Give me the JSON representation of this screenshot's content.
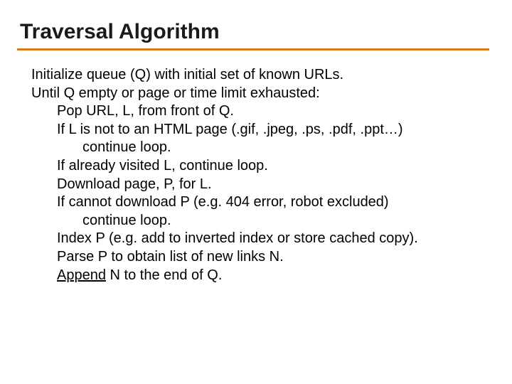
{
  "slide": {
    "title": "Traversal Algorithm",
    "lines": {
      "l1": "Initialize queue (Q) with initial set of known URLs.",
      "l2": "Until Q empty or page or time limit exhausted:",
      "l3": "Pop URL, L, from front of Q.",
      "l4": "If L is not to an HTML page (.gif, .jpeg, .ps, .pdf, .ppt…)",
      "l5": "continue loop.",
      "l6": "If already visited L, continue loop.",
      "l7": "Download page, P, for L.",
      "l8": "If cannot download P (e.g. 404 error, robot excluded)",
      "l9": "continue loop.",
      "l10": "Index P (e.g. add to inverted index or store cached copy).",
      "l11": "Parse P to obtain list of new links N.",
      "l12_u": "Append",
      "l12_r": " N to the end of Q."
    }
  },
  "colors": {
    "rule": "#d97a1e"
  }
}
